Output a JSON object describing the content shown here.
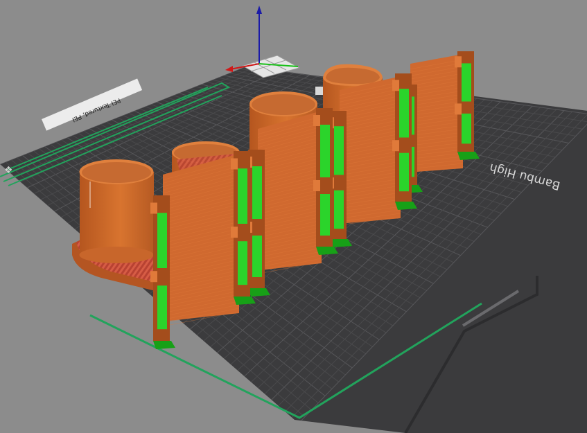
{
  "app": {
    "view": "3D preview – sliced plate"
  },
  "plate": {
    "label_main": "Bambu High",
    "label_strip": "PEI Textured, PEI",
    "logo_glyph": "❖"
  },
  "colors": {
    "background": "#8c8c8c",
    "plate": "#3b3b3d",
    "grid_line": "#4a4a4c",
    "grid_major": "#57575a",
    "boundary": "#22a35c",
    "part_orange": "#d0692f",
    "part_orange_dark": "#a44d1c",
    "part_orange_light": "#e07a3a",
    "support_green": "#2bd42b",
    "support_green_dark": "#17a017",
    "infill_red": "#c94a3a",
    "axis_z": "#1a1aa8",
    "axis_x": "#d01818",
    "axis_y": "#18c018"
  },
  "icons": {
    "axis_gizmo": "xyz-axis-gizmo-icon",
    "plate_logo": "bambu-logo-icon"
  }
}
